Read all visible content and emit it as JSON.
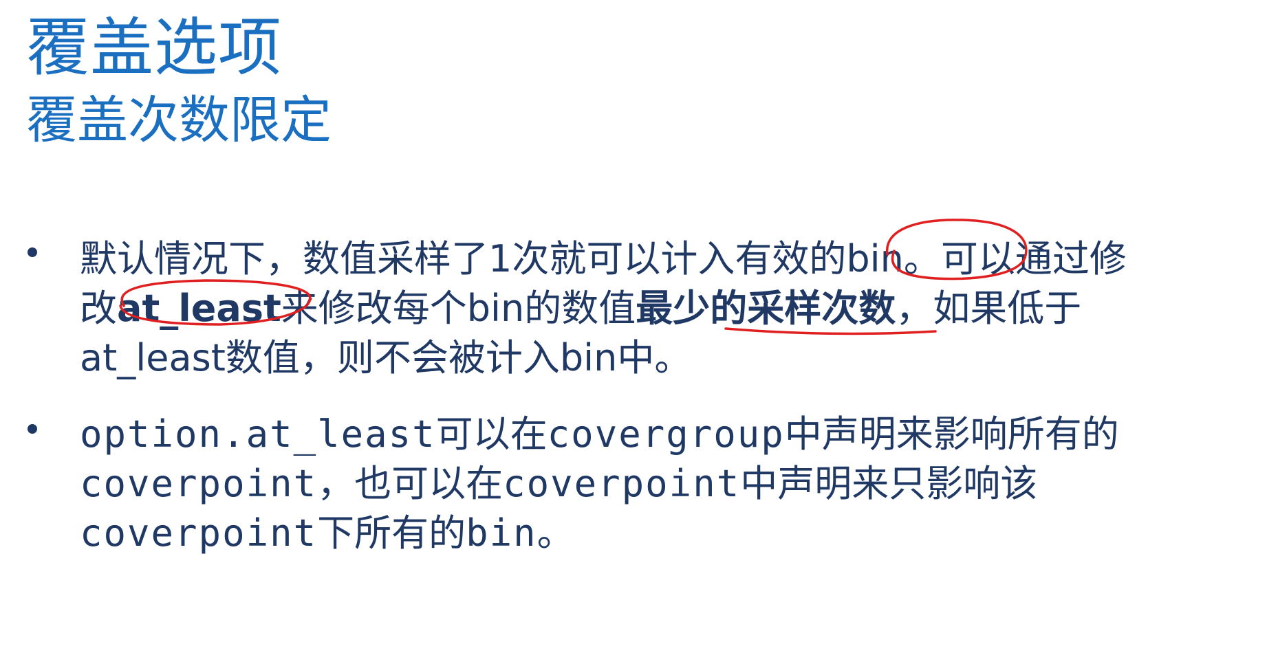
{
  "title": "覆盖选项",
  "subtitle": "覆盖次数限定",
  "bullet1": {
    "line1": "默认情况下，数值采样了1次就可以计入有效的bin。可以通过修",
    "line2_a": "改",
    "line2_b": "at_least",
    "line2_c": "来修改每个bin的数值",
    "line2_d": "最少的采样次数",
    "line2_e": "，如果低于",
    "line3": "at_least数值，则不会被计入bin中。"
  },
  "bullet2": {
    "line1_a": "option.at_least",
    "line1_b": "可以在",
    "line1_c": "covergroup",
    "line1_d": "中声明来影响所有的",
    "line2_a": "coverpoint",
    "line2_b": "，也可以在",
    "line2_c": "coverpoint",
    "line2_d": "中声明来只影响该",
    "line3_a": "coverpoint",
    "line3_b": "下所有的",
    "line3_c": "bin",
    "line3_d": "。"
  },
  "colors": {
    "title": "#1b6fc1",
    "body": "#1f3864",
    "annotation": "#e02020"
  }
}
